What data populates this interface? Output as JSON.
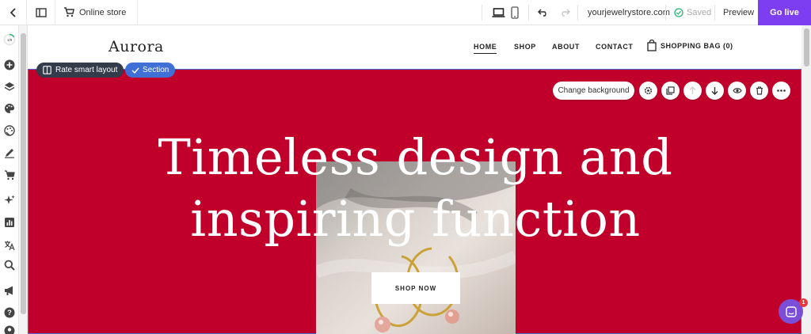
{
  "toolbar": {
    "store_label": "Online store",
    "domain": "yourjewelrystore.com",
    "saved_label": "Saved",
    "preview_label": "Preview",
    "golive_label": "Go live",
    "accent": "#7c3ef0"
  },
  "sidebar": {
    "progress_label": "1/9",
    "icons": [
      "progress-ring-icon",
      "add-icon",
      "layers-icon",
      "palette-icon",
      "theme-icon",
      "pen-icon",
      "cart-icon",
      "sparkle-icon",
      "analytics-icon",
      "translate-icon",
      "search-icon",
      "megaphone-icon",
      "help-icon",
      "account-icon"
    ]
  },
  "site": {
    "logo": "Aurora",
    "nav": {
      "home": "HOME",
      "shop": "SHOP",
      "about": "ABOUT",
      "contact": "CONTACT",
      "bag": "SHOPPING BAG (0)"
    },
    "hero": {
      "title_line1": "Timeless design and",
      "title_line2": "inspiring function",
      "cta": "SHOP NOW",
      "background": "#c0002b"
    }
  },
  "editor": {
    "rate_label": "Rate smart layout",
    "section_label": "Section",
    "change_background_label": "Change background",
    "section_tools": [
      "settings-icon",
      "duplicate-icon",
      "move-up-icon",
      "move-down-icon",
      "visibility-icon",
      "delete-icon",
      "more-icon"
    ]
  },
  "chat": {
    "badge_count": "1"
  }
}
